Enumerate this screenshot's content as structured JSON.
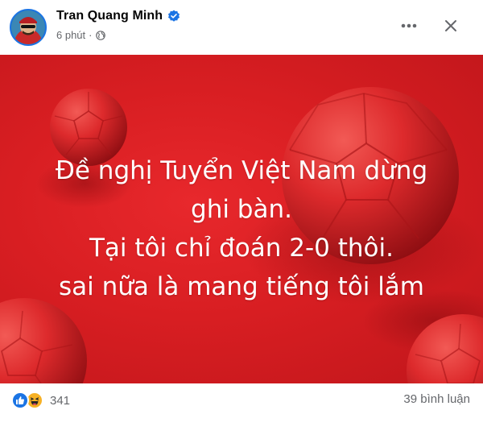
{
  "post": {
    "author": "Tran Quang Minh",
    "time": "6 phút",
    "separator": "·",
    "verified": true,
    "privacy_icon": "globe-icon",
    "more_icon": "more-horizontal-icon",
    "close_icon": "close-icon"
  },
  "image": {
    "background_color": "#d81e22",
    "lines": [
      "Đề nghị Tuyển Việt Nam dừng",
      "ghi bàn.",
      "Tại tôi chỉ đoán 2-0 thôi.",
      "sai nữa là mang tiếng tôi lắm"
    ]
  },
  "footer": {
    "reactions": [
      "like-icon",
      "haha-icon"
    ],
    "reaction_count": "341",
    "comments_label": "39 bình luận"
  }
}
